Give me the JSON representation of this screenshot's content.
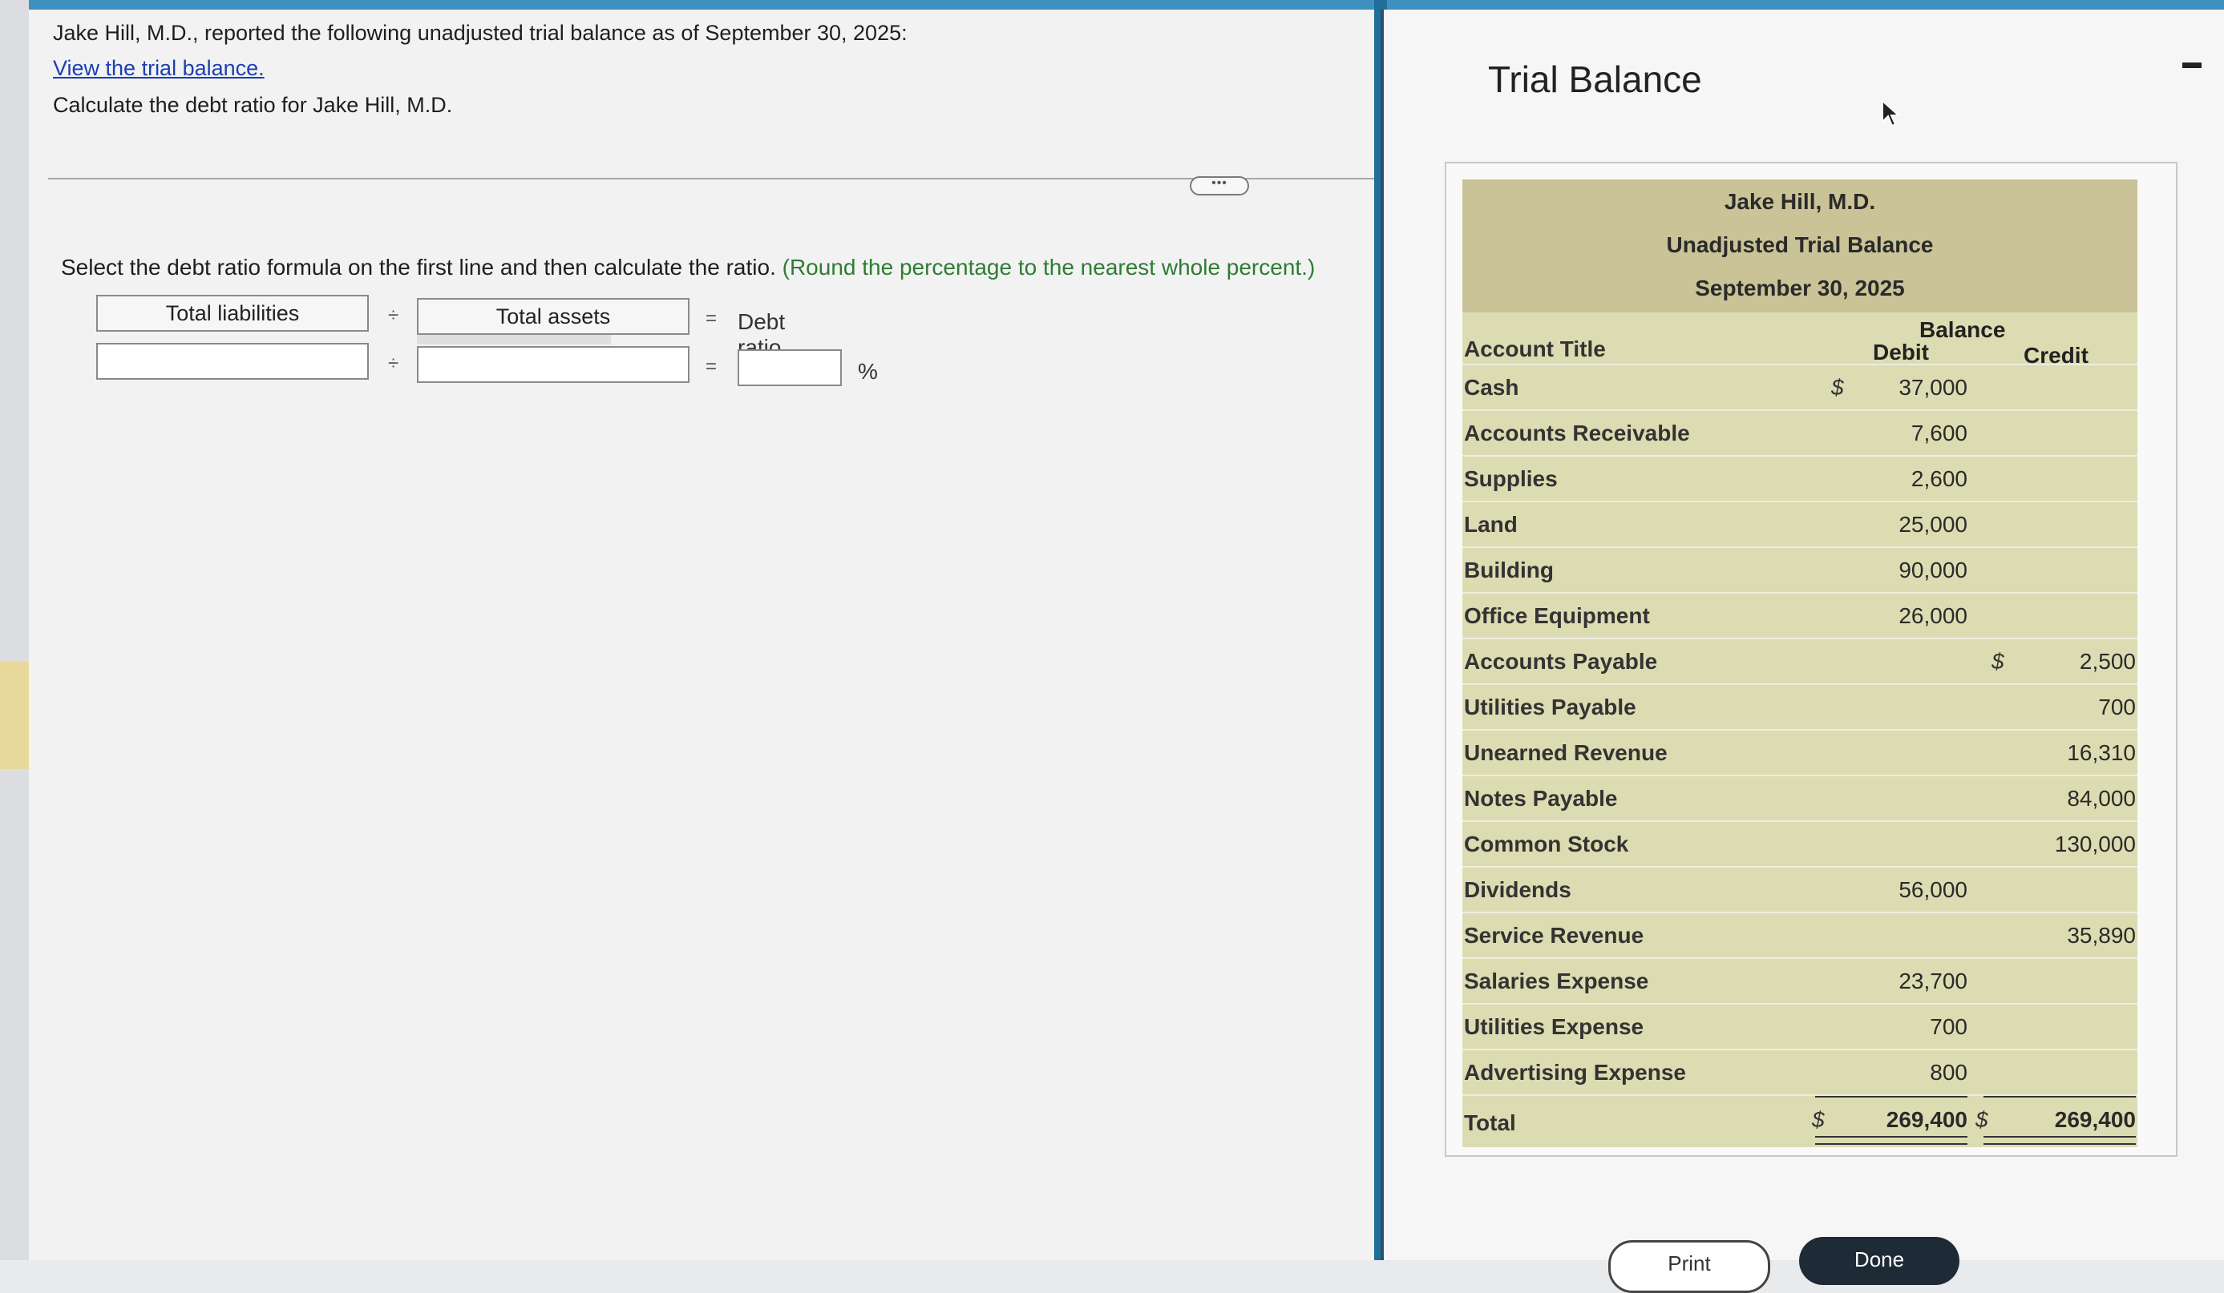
{
  "question": {
    "line1": "Jake Hill, M.D., reported the following unadjusted trial balance as of September 30, 2025:",
    "link": "View the trial balance.",
    "line3": "Calculate the debt ratio for Jake Hill, M.D."
  },
  "instruction": {
    "main": "Select the debt ratio formula on the first line and then calculate the ratio.",
    "hint": "(Round the percentage to the nearest whole percent.)"
  },
  "formula": {
    "numerator_label": "Total liabilities",
    "divide_symbol": "÷",
    "denominator_label": "Total assets",
    "equals_symbol": "=",
    "result_label": "Debt ratio",
    "numerator_value": "",
    "denominator_value": "",
    "result_value": "",
    "percent_symbol": "%"
  },
  "panel": {
    "title": "Trial Balance",
    "print_label": "Print",
    "done_label": "Done"
  },
  "trial_balance": {
    "company": "Jake Hill, M.D.",
    "report": "Unadjusted Trial Balance",
    "date": "September 30, 2025",
    "balance_header": "Balance",
    "account_title_header": "Account Title",
    "debit_header": "Debit",
    "credit_header": "Credit",
    "currency": "$",
    "rows": [
      {
        "account": "Cash",
        "debit": "37,000",
        "credit": ""
      },
      {
        "account": "Accounts Receivable",
        "debit": "7,600",
        "credit": ""
      },
      {
        "account": "Supplies",
        "debit": "2,600",
        "credit": ""
      },
      {
        "account": "Land",
        "debit": "25,000",
        "credit": ""
      },
      {
        "account": "Building",
        "debit": "90,000",
        "credit": ""
      },
      {
        "account": "Office Equipment",
        "debit": "26,000",
        "credit": ""
      },
      {
        "account": "Accounts Payable",
        "debit": "",
        "credit": "2,500"
      },
      {
        "account": "Utilities Payable",
        "debit": "",
        "credit": "700"
      },
      {
        "account": "Unearned Revenue",
        "debit": "",
        "credit": "16,310"
      },
      {
        "account": "Notes Payable",
        "debit": "",
        "credit": "84,000"
      },
      {
        "account": "Common Stock",
        "debit": "",
        "credit": "130,000"
      },
      {
        "account": "Dividends",
        "debit": "56,000",
        "credit": ""
      },
      {
        "account": "Service Revenue",
        "debit": "",
        "credit": "35,890"
      },
      {
        "account": "Salaries Expense",
        "debit": "23,700",
        "credit": ""
      },
      {
        "account": "Utilities Expense",
        "debit": "700",
        "credit": ""
      },
      {
        "account": "Advertising Expense",
        "debit": "800",
        "credit": ""
      }
    ],
    "total_label": "Total",
    "total_debit": "269,400",
    "total_credit": "269,400"
  }
}
